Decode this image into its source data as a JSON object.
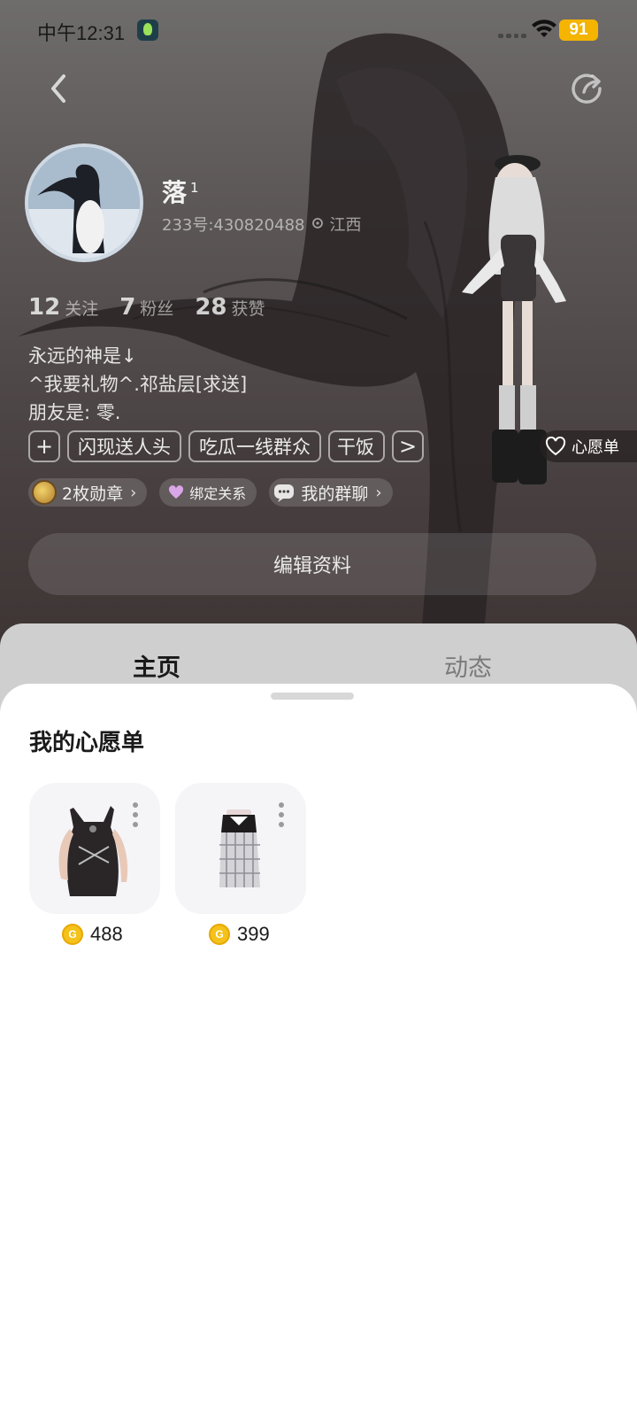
{
  "status_bar": {
    "time": "中午12:31",
    "battery": "91"
  },
  "profile": {
    "name": "落",
    "name_sup": "1",
    "id_text": "233号:430820488",
    "location": "江西",
    "stats": [
      {
        "num": "12",
        "label": "关注"
      },
      {
        "num": "7",
        "label": "粉丝"
      },
      {
        "num": "28",
        "label": "获赞"
      }
    ],
    "bio_lines": [
      "永远的神是↓",
      "^我要礼物^.祁盐层[求送]",
      "朋友是: 零."
    ],
    "tags": [
      "闪现送人头",
      "吃瓜一线群众",
      "干饭"
    ],
    "tag_add": "+",
    "tag_more": ">",
    "wishlist_label": "心愿单",
    "chips": {
      "medals": "2枚勋章",
      "bind": "绑定关系",
      "groups": "我的群聊"
    },
    "edit_button": "编辑资料"
  },
  "tabs": {
    "home": "主页",
    "feed": "动态"
  },
  "wishlist": {
    "title": "我的心愿单",
    "items": [
      {
        "name": "halter-top",
        "price": "488"
      },
      {
        "name": "plaid-dress",
        "price": "399"
      }
    ]
  },
  "colors": {
    "coin": "#f4c21a",
    "battery": "#f4b400",
    "hero_top": "#6f6c6c",
    "hero_bottom": "#3a3030"
  }
}
